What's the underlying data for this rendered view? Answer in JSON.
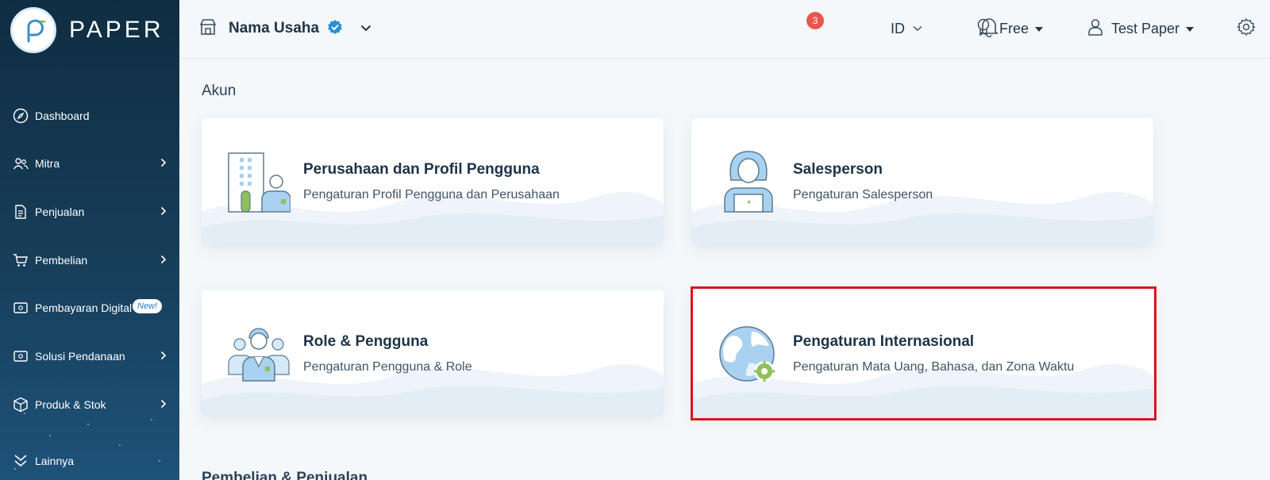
{
  "brand": {
    "name": "PAPER"
  },
  "sidebar": {
    "items": [
      {
        "label": "Dashboard",
        "icon": "compass-icon",
        "has_chevron": false
      },
      {
        "label": "Mitra",
        "icon": "users-icon",
        "has_chevron": true
      },
      {
        "label": "Penjualan",
        "icon": "document-icon",
        "has_chevron": true
      },
      {
        "label": "Pembelian",
        "icon": "cart-icon",
        "has_chevron": true
      },
      {
        "label": "Pembayaran Digital",
        "icon": "wallet-icon",
        "has_chevron": true,
        "badge": "New!"
      },
      {
        "label": "Solusi Pendanaan",
        "icon": "cash-icon",
        "has_chevron": true
      },
      {
        "label": "Produk & Stok",
        "icon": "box-icon",
        "has_chevron": true
      },
      {
        "label": "Lainnya",
        "icon": "double-chevron-down-icon",
        "has_chevron": false
      }
    ]
  },
  "header": {
    "business_name": "Nama Usaha",
    "notification_count": "3",
    "language": "ID",
    "plan": "Free",
    "user": "Test Paper"
  },
  "main": {
    "section_title": "Akun",
    "next_section_title": "Pembelian & Penjualan",
    "cards": [
      {
        "title": "Perusahaan dan Profil Pengguna",
        "desc": "Pengaturan Profil Pengguna dan Perusahaan",
        "icon": "company-profile-icon"
      },
      {
        "title": "Salesperson",
        "desc": "Pengaturan Salesperson",
        "icon": "salesperson-icon"
      },
      {
        "title": "Role & Pengguna",
        "desc": "Pengaturan Pengguna & Role",
        "icon": "team-icon"
      },
      {
        "title": "Pengaturan Internasional",
        "desc": "Pengaturan Mata Uang, Bahasa, dan Zona Waktu",
        "icon": "globe-gear-icon",
        "highlighted": true
      }
    ]
  },
  "colors": {
    "sidebar_top": "#0f2d42",
    "sidebar_bottom": "#1e5279",
    "highlight": "#d9161c",
    "notif": "#e8574e",
    "verified": "#2a8fd6"
  }
}
